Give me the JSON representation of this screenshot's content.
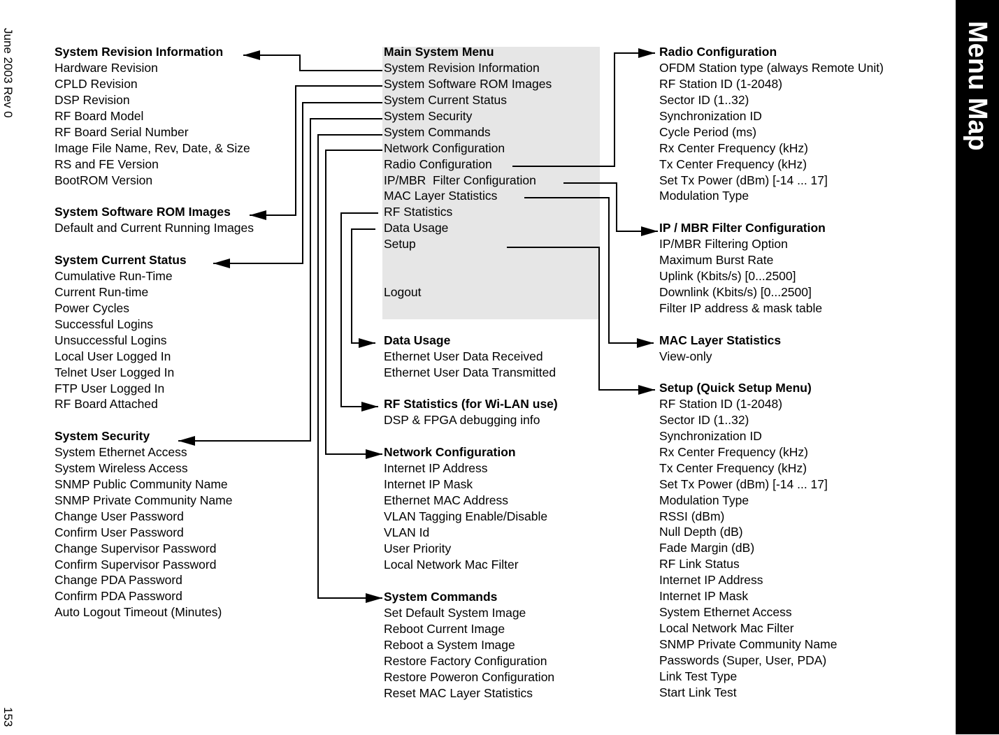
{
  "page": {
    "section_title": "Menu Map",
    "footer_date": "June 2003 Rev 0",
    "page_number": "153"
  },
  "main_menu": {
    "title": "Main System Menu",
    "items": [
      "System Revision Information",
      "System Software ROM Images",
      "System Current Status",
      "System Security",
      "System Commands",
      "Network Configuration",
      "Radio Configuration",
      "IP/MBR  Filter Configuration",
      "MAC Layer Statistics",
      "RF Statistics",
      "Data Usage",
      "Setup",
      "",
      "",
      "Logout"
    ]
  },
  "submenus": {
    "system_revision": {
      "title": "System Revision Information",
      "items": [
        "Hardware Revision",
        "CPLD Revision",
        "DSP Revision",
        "RF Board Model",
        "RF Board Serial Number",
        "Image File Name, Rev, Date, & Size",
        "RS and FE Version",
        "BootROM Version"
      ]
    },
    "software_rom": {
      "title": "System Software ROM Images",
      "items": [
        "Default and Current Running Images"
      ]
    },
    "current_status": {
      "title": "System Current Status",
      "items": [
        "Cumulative Run-Time",
        "Current Run-time",
        "Power Cycles",
        "Successful Logins",
        "Unsuccessful Logins",
        "Local User Logged In",
        "Telnet User Logged In",
        "FTP User Logged In",
        "RF Board Attached"
      ]
    },
    "security": {
      "title": "System Security",
      "items": [
        "System Ethernet Access",
        "System Wireless Access",
        "SNMP Public Community Name",
        "SNMP Private Community Name",
        "Change User Password",
        "Confirm User Password",
        "Change Supervisor Password",
        "Confirm Supervisor Password",
        "Change PDA Password",
        "Confirm PDA Password",
        "Auto Logout Timeout (Minutes)"
      ]
    },
    "data_usage": {
      "title": "Data Usage",
      "items": [
        "Ethernet User Data Received",
        "Ethernet User Data Transmitted"
      ]
    },
    "rf_statistics": {
      "title": "RF Statistics (for Wi-LAN use)",
      "items": [
        "DSP & FPGA debugging info"
      ]
    },
    "network_config": {
      "title": "Network Configuration",
      "items": [
        "Internet IP Address",
        "Internet IP Mask",
        "Ethernet MAC Address",
        "VLAN Tagging Enable/Disable",
        "VLAN Id",
        "User Priority",
        "Local Network Mac Filter"
      ]
    },
    "system_commands": {
      "title": "System Commands",
      "items": [
        "Set Default System Image",
        "Reboot Current Image",
        "Reboot a System Image",
        "Restore Factory Configuration",
        "Restore Poweron Configuration",
        "Reset MAC Layer Statistics"
      ]
    },
    "radio_config": {
      "title": "Radio Configuration",
      "items": [
        "OFDM Station type (always Remote Unit)",
        "RF Station ID (1-2048)",
        "Sector ID (1..32)",
        "Synchronization ID",
        "Cycle Period (ms)",
        "Rx Center Frequency (kHz)",
        "Tx Center Frequency (kHz)",
        "Set Tx Power (dBm) [-14 ... 17]",
        "Modulation Type"
      ]
    },
    "ip_mbr_filter": {
      "title": "IP / MBR Filter Configuration",
      "items": [
        "IP/MBR Filtering Option",
        "Maximum Burst Rate",
        "Uplink (Kbits/s) [0...2500]",
        "Downlink (Kbits/s) [0...2500]",
        "Filter IP address & mask table"
      ]
    },
    "mac_layer": {
      "title": "MAC Layer Statistics",
      "items": [
        "View-only"
      ]
    },
    "setup": {
      "title": "Setup (Quick Setup Menu)",
      "items": [
        "RF Station ID (1-2048)",
        "Sector ID (1..32)",
        "Synchronization ID",
        "Rx Center Frequency (kHz)",
        "Tx Center Frequency (kHz)",
        "Set Tx Power (dBm) [-14 ... 17]",
        "Modulation Type",
        "RSSI (dBm)",
        "Null Depth (dB)",
        "Fade Margin (dB)",
        "RF Link Status",
        "Internet IP Address",
        "Internet IP Mask",
        "System Ethernet Access",
        "Local Network Mac Filter",
        "SNMP Private Community Name",
        "Passwords (Super, User, PDA)",
        "Link Test Type",
        "Start Link Test"
      ]
    }
  },
  "connections": [
    {
      "from": "System Revision Information",
      "to": "system_revision"
    },
    {
      "from": "System Software ROM Images",
      "to": "software_rom"
    },
    {
      "from": "System Current Status",
      "to": "current_status"
    },
    {
      "from": "System Security",
      "to": "security"
    },
    {
      "from": "System Commands",
      "to": "system_commands"
    },
    {
      "from": "Network Configuration",
      "to": "network_config"
    },
    {
      "from": "Radio Configuration",
      "to": "radio_config"
    },
    {
      "from": "IP/MBR  Filter Configuration",
      "to": "ip_mbr_filter"
    },
    {
      "from": "MAC Layer Statistics",
      "to": "mac_layer"
    },
    {
      "from": "RF Statistics",
      "to": "rf_statistics"
    },
    {
      "from": "Data Usage",
      "to": "data_usage"
    },
    {
      "from": "Setup",
      "to": "setup"
    }
  ]
}
